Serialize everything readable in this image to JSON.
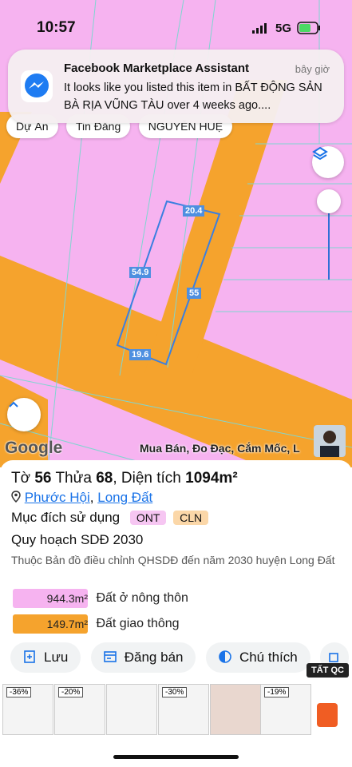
{
  "status_bar": {
    "time": "10:57",
    "network": "5G"
  },
  "notification": {
    "app": "Facebook Marketplace Assistant",
    "time": "bây giờ",
    "message": "It looks like you listed this item in BẤT ĐỘNG SẢN BÀ RỊA VŨNG TÀU over 4 weeks ago...."
  },
  "filter_chips": [
    "Dự Án",
    "Tin Đăng",
    "NGUYỄN HUỆ"
  ],
  "map": {
    "dimensions": [
      "20.4",
      "54.9",
      "55",
      "19.6"
    ],
    "google_label": "Google",
    "watermark": "Mua Bán, Đo Đạc, Cắm Mốc, L"
  },
  "parcel": {
    "sheet_label": "Tờ",
    "sheet": "56",
    "plot_label": "Thửa",
    "plot": "68",
    "area_label": "Diện tích",
    "area": "1094m²",
    "ward": "Phước Hội",
    "district": "Long Đất",
    "usage_label": "Mục đích sử dụng",
    "usage_codes": [
      "ONT",
      "CLN"
    ],
    "plan_title": "Quy hoạch SDĐ 2030",
    "plan_note": "Thuộc Bản đồ điều chỉnh QHSDĐ đến năm 2030 huyện Long Đất",
    "land_types": [
      {
        "area": "944.3m²",
        "label": "Đất ở nông thôn",
        "color": "#f6b3f0"
      },
      {
        "area": "149.7m²",
        "label": "Đất giao thông",
        "color": "#f5a32d"
      }
    ]
  },
  "actions": [
    "Lưu",
    "Đăng bán",
    "Chú thích"
  ],
  "ads": {
    "label": "TẤT QC",
    "discounts": [
      "-36%",
      "-20%",
      "-30%",
      "-19%"
    ]
  },
  "colors": {
    "road": "#f5a32d",
    "residential": "#f6b3f0",
    "accent": "#1a73e8",
    "parcel_line": "#3a7fe0"
  }
}
